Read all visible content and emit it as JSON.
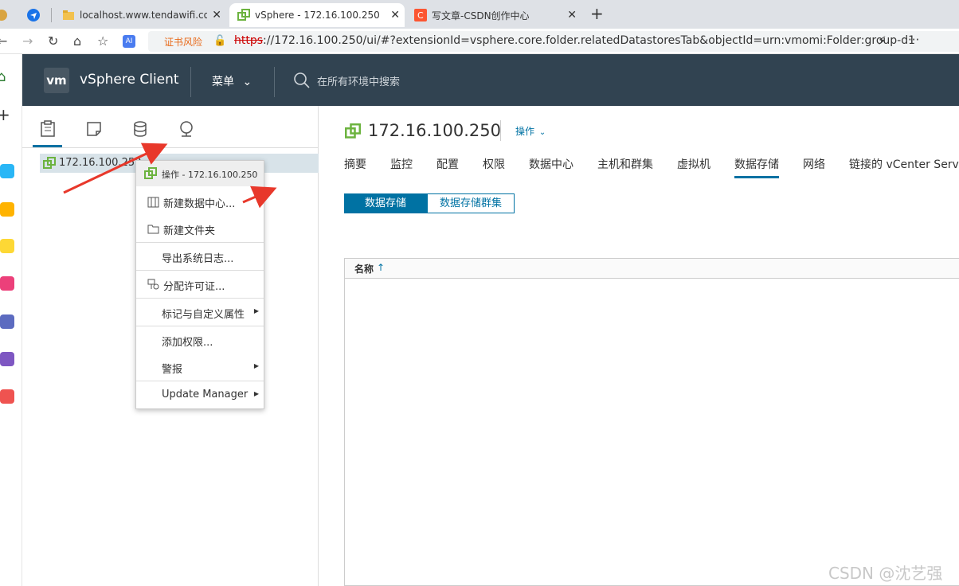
{
  "browser": {
    "tabs": [
      {
        "title": "localhost.www.tendawifi.com",
        "favicon": "folder-icon",
        "active": false
      },
      {
        "title": "vSphere - 172.16.100.250 - ",
        "favicon": "vsphere-icon",
        "active": true
      },
      {
        "title": "写文章-CSDN创作中心",
        "favicon": "csdn-icon",
        "active": false
      }
    ],
    "cert_warning": "证书风险",
    "url_protocol": "https",
    "url_rest": "://172.16.100.250/ui/#?extensionId=vsphere.core.folder.relatedDatastoresTab&objectId=urn:vmomi:Folder:group-d1",
    "more": "···"
  },
  "vsphere": {
    "logo": "vm",
    "app_title": "vSphere Client",
    "menu_label": "菜单",
    "search_placeholder": "在所有环境中搜索"
  },
  "navigator": {
    "tabs": [
      "hosts-and-clusters-icon",
      "vms-and-templates-icon",
      "storage-icon",
      "networking-icon"
    ],
    "tree_item": "172.16.100.250"
  },
  "context_menu": {
    "header": "操作 - 172.16.100.250",
    "items": [
      {
        "label": "新建数据中心...",
        "icon": "datacenter-icon",
        "submenu": false
      },
      {
        "label": "新建文件夹",
        "icon": "folder-icon",
        "submenu": false
      },
      {
        "label": "导出系统日志...",
        "icon": "",
        "submenu": false
      },
      {
        "label": "分配许可证...",
        "icon": "license-icon",
        "submenu": false
      },
      {
        "label": "标记与自定义属性",
        "icon": "",
        "submenu": true
      },
      {
        "label": "添加权限...",
        "icon": "",
        "submenu": false
      },
      {
        "label": "警报",
        "icon": "",
        "submenu": true
      },
      {
        "label": "Update Manager",
        "icon": "",
        "submenu": true
      }
    ]
  },
  "main": {
    "object_title": "172.16.100.250",
    "actions_label": "操作",
    "tabs": [
      "摘要",
      "监控",
      "配置",
      "权限",
      "数据中心",
      "主机和群集",
      "虚拟机",
      "数据存储",
      "网络",
      "链接的 vCenter Serve"
    ],
    "active_tab": "数据存储",
    "segments": [
      "数据存储",
      "数据存储群集"
    ],
    "grid_column": "名称",
    "sort_indicator": "↑"
  },
  "watermark": "CSDN @沈艺强",
  "colors": {
    "accent": "#0072a3",
    "header_bg": "#314351",
    "annotation_arrow": "#e8382b"
  }
}
